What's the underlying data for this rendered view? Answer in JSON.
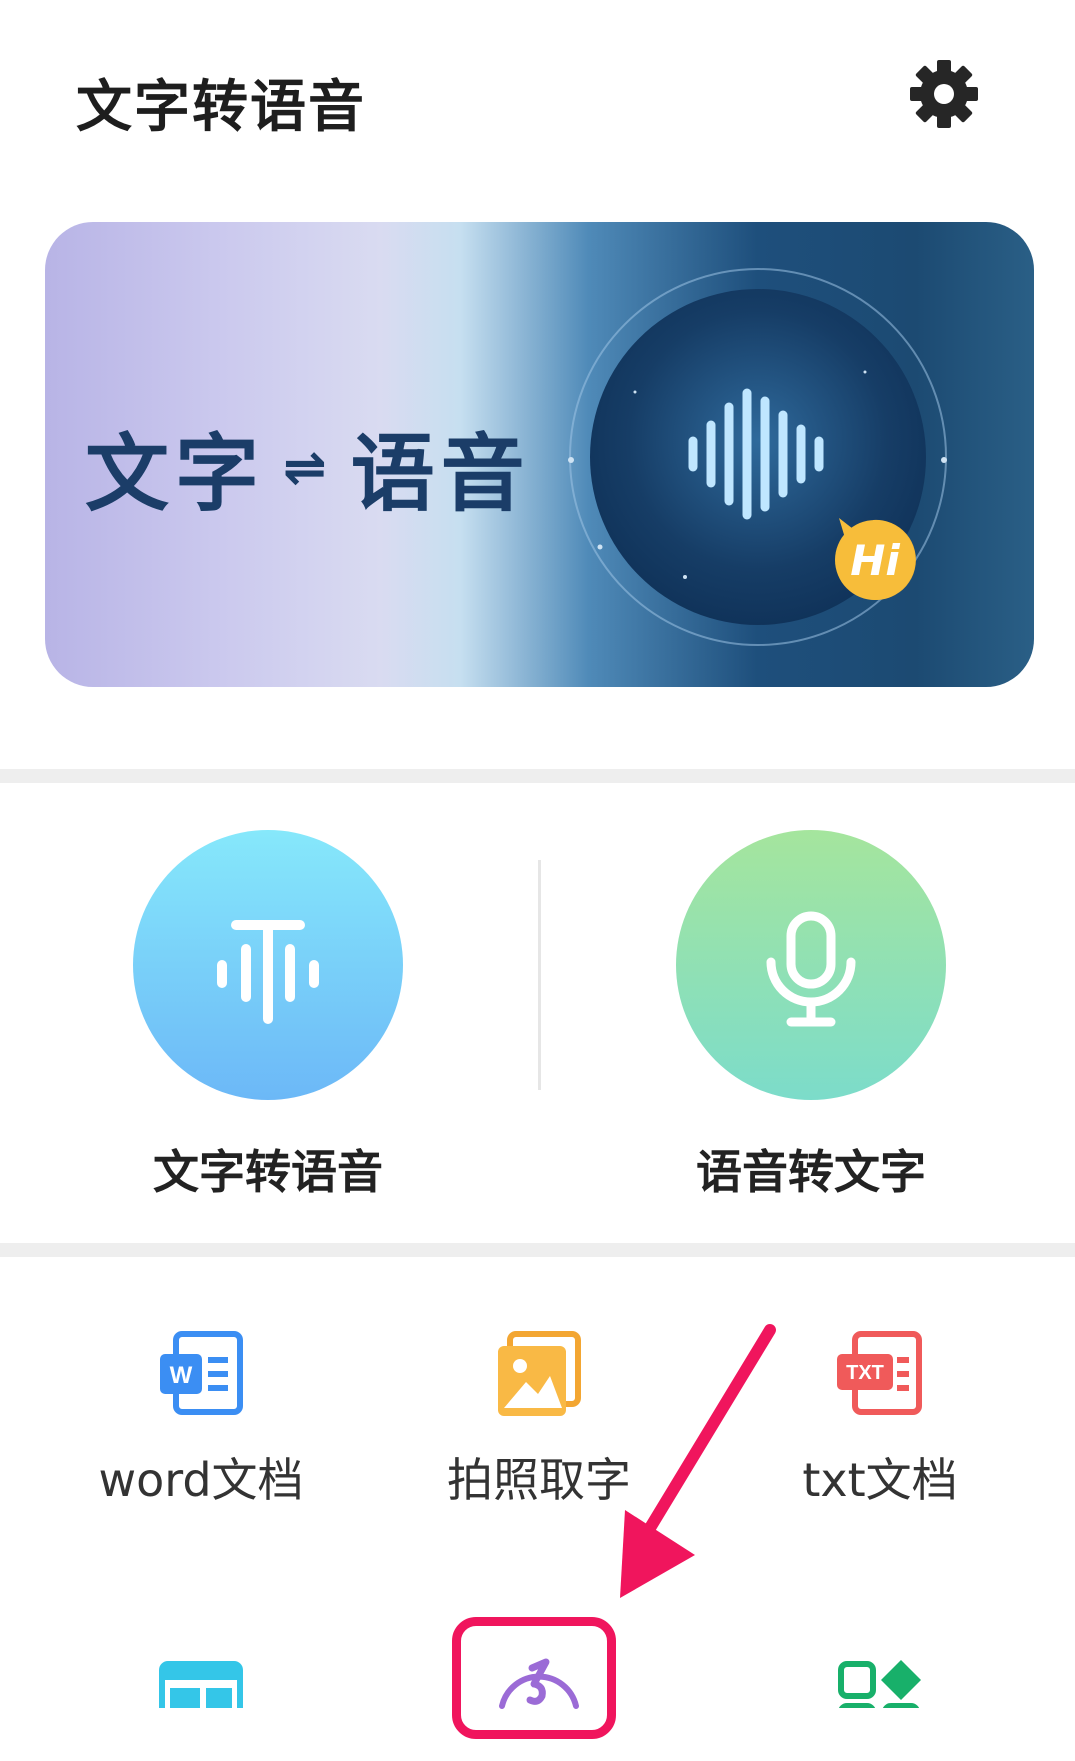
{
  "header": {
    "title": "文字转语音",
    "settings_icon": "gear-icon"
  },
  "banner": {
    "left_text": "文字",
    "swap_symbol": "⇌",
    "right_text": "语音",
    "bubble_text": "Hi",
    "icon": "soundwave-icon"
  },
  "features": [
    {
      "label": "文字转语音",
      "icon": "text-to-speech-icon",
      "color_top": "#86e8fb",
      "color_bottom": "#6cb8f7"
    },
    {
      "label": "语音转文字",
      "icon": "microphone-icon",
      "color_top": "#a5e59d",
      "color_bottom": "#7cdcca"
    }
  ],
  "tools": [
    {
      "label": "word文档",
      "icon": "word-doc-icon",
      "color": "#3b8ef3"
    },
    {
      "label": "拍照取字",
      "icon": "photo-icon",
      "color": "#f3a632"
    },
    {
      "label": "txt文档",
      "icon": "txt-doc-icon",
      "color": "#f05a5a"
    }
  ],
  "tools_row2": [
    {
      "icon": "webpage-icon",
      "color": "#34c6e8"
    },
    {
      "icon": "music-note-icon",
      "color": "#9b6bd6"
    },
    {
      "icon": "apps-grid-icon",
      "color": "#18b06a"
    }
  ],
  "annotation": {
    "color": "#f0155d"
  }
}
